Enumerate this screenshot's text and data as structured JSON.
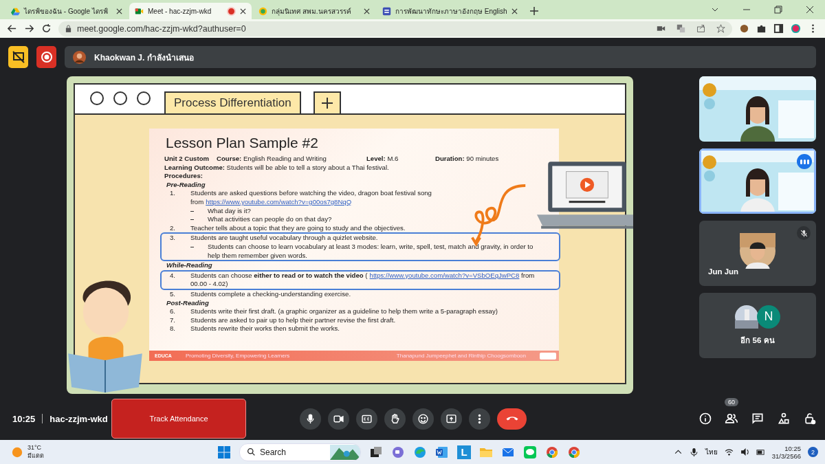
{
  "browser": {
    "tabs": [
      {
        "kind": "drive",
        "title": "ไดรฟ์ของฉัน - Google ไดรฟ์",
        "selected": false,
        "recording": false
      },
      {
        "kind": "meet",
        "title": "Meet - hac-zzjm-wkd",
        "selected": true,
        "recording": true
      },
      {
        "kind": "globe",
        "title": "กลุ่มนิเทศ สพม.นครสวรรค์",
        "selected": false,
        "recording": false
      },
      {
        "kind": "form",
        "title": "การพัฒนาทักษะภาษาอังกฤษ English",
        "selected": false,
        "recording": false
      }
    ],
    "url": "meet.google.com/hac-zzjm-wkd?authuser=0"
  },
  "meet": {
    "presenter": "Khaokwan J. กำลังนำเสนอ",
    "stage": {
      "window_tabs": [
        {
          "title": "Process Differentiation",
          "kind": "text"
        },
        {
          "kind": "add"
        }
      ],
      "slide": {
        "title": "Lesson Plan Sample #2",
        "meta": [
          {
            "label": "Unit 2 Custom"
          },
          {
            "label": "Course:",
            "value": "English Reading and Writing"
          },
          {
            "label": "Level:",
            "value": "M.6"
          },
          {
            "label": "Duration:",
            "value": "90 minutes"
          }
        ],
        "outcome": {
          "label": "Learning Outcome:",
          "value": "Students will be able to tell a story about a Thai festival."
        },
        "procedures_label": "Procedures:",
        "sections": [
          {
            "heading": "Pre-Reading",
            "items": [
              {
                "number": "1.",
                "text": "Students are asked questions before watching the video, dragon boat festival song from",
                "link": "https://www.youtube.com/watch?v=g00os7g8NqQ",
                "highlighted": false,
                "subitems": [
                  "What day is it?",
                  "What activities can people do on that day?"
                ]
              },
              {
                "number": "2.",
                "text": "Teacher tells about a topic that they are going to study and the objectives.",
                "highlighted": false
              },
              {
                "number": "3.",
                "text": "Students are taught useful vocabulary through a quizlet website.",
                "highlighted": true,
                "subitems": [
                  "Students can choose to learn vocabulary at least 3 modes: learn, write, spell, test, match and gravity, in order to help them remember given words."
                ]
              }
            ]
          },
          {
            "heading": "While-Reading",
            "items": [
              {
                "number": "4.",
                "text": "Students can choose **either to read or to watch the video** (",
                "link": "https://www.youtube.com/watch?v=VSbOEqJwPC8",
                "after": "from 00.00 - 4.02)",
                "highlighted": true
              },
              {
                "number": "5.",
                "text": "Students complete a checking-understanding exercise.",
                "highlighted": false
              }
            ]
          },
          {
            "heading": "Post-Reading",
            "items": [
              {
                "number": "6.",
                "text": "Students write their first draft. (a graphic organizer as a guideline to help them write a 5-paragraph essay)",
                "highlighted": false
              },
              {
                "number": "7.",
                "text": "Students are asked to pair up to help their partner revise the first draft.",
                "highlighted": false
              },
              {
                "number": "8.",
                "text": "Students rewrite their works then submit the works.",
                "highlighted": false
              }
            ]
          }
        ],
        "footer": {
          "logo": "EDUCA",
          "left": "Promoting Diversity, Empowering Learners",
          "right": "Thanapund Jumpeephet and Rinthip Choogsomboon"
        }
      }
    },
    "tiles": [
      {
        "kind": "video",
        "speaking": false
      },
      {
        "kind": "video",
        "speaking": true
      },
      {
        "kind": "avatar",
        "name": "Jun Jun",
        "muted": true
      },
      {
        "kind": "others",
        "initial": "N",
        "label": "อีก 56 คน"
      }
    ],
    "time": "10:25",
    "code": "hac-zzjm-wkd",
    "attendance": "Track Attendance",
    "controls": [
      {
        "kind": "mic"
      },
      {
        "kind": "camera"
      },
      {
        "kind": "captions"
      },
      {
        "kind": "hand"
      },
      {
        "kind": "emoji"
      },
      {
        "kind": "present"
      },
      {
        "kind": "more"
      },
      {
        "kind": "hangup"
      }
    ],
    "side_controls": [
      {
        "kind": "info"
      },
      {
        "kind": "people",
        "badge": "60"
      },
      {
        "kind": "chat"
      },
      {
        "kind": "activities"
      },
      {
        "kind": "lock"
      }
    ]
  },
  "taskbar": {
    "temperature": "31°C",
    "weather": "มีแดด",
    "search": "Search",
    "apps": [
      {
        "kind": "taskview"
      },
      {
        "kind": "chat"
      },
      {
        "kind": "edge"
      },
      {
        "kind": "word"
      },
      {
        "kind": "letter",
        "letter": "L"
      },
      {
        "kind": "folder"
      },
      {
        "kind": "mail"
      },
      {
        "kind": "line"
      },
      {
        "kind": "chrome"
      },
      {
        "kind": "chrome"
      }
    ],
    "language": "ไทย",
    "time": "10:25",
    "date": "31/3/2566",
    "notifications": "2"
  }
}
